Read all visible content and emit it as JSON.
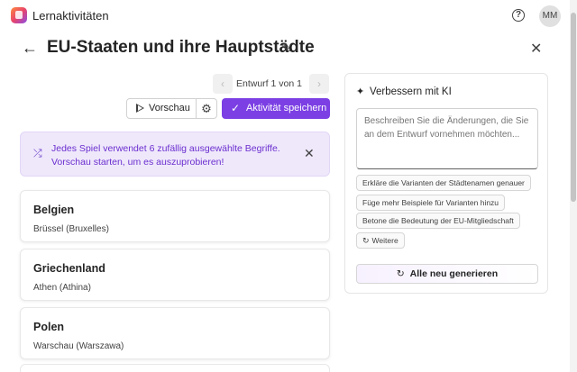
{
  "app": {
    "title": "Lernaktivitäten",
    "user_initials": "MM"
  },
  "header": {
    "title": "EU-Staaten und ihre Hauptstädte"
  },
  "draft": {
    "label": "Entwurf 1 von 1",
    "prev": "‹",
    "next": "›"
  },
  "toolbar": {
    "preview_label": "Vorschau",
    "save_label": "Aktivität speichern"
  },
  "banner": {
    "text": "Jedes Spiel verwendet 6 zufällig ausgewählte Begriffe. Vorschau starten, um es auszuprobieren!"
  },
  "cards": [
    {
      "title": "Belgien",
      "subtitle": "Brüssel (Bruxelles)"
    },
    {
      "title": "Griechenland",
      "subtitle": "Athen (Athina)"
    },
    {
      "title": "Polen",
      "subtitle": "Warschau (Warszawa)"
    }
  ],
  "panel": {
    "title": "Verbessern mit KI",
    "input_placeholder": "Beschreiben Sie die Änderungen, die Sie an dem Entwurf vornehmen möchten...",
    "suggestions": [
      "Erkläre die Varianten der Städtenamen genauer",
      "Füge mehr Beispiele für Varianten hinzu",
      "Betone die Bedeutung der EU-Mitgliedschaft"
    ],
    "more_label": "Weitere",
    "regenerate_label": "Alle neu generieren"
  },
  "icons": {
    "back": "arrow-left-icon",
    "edit": "pencil-icon",
    "close": "close-icon",
    "help": "help-circle-icon",
    "play": "play-icon",
    "settings": "gear-icon",
    "check": "check-icon",
    "shuffle": "shuffle-icon",
    "sparkle": "sparkle-icon",
    "refresh": "refresh-icon"
  },
  "colors": {
    "accent": "#7b3fe4",
    "banner_bg": "#efe8fb",
    "banner_text": "#6b2fcf"
  }
}
